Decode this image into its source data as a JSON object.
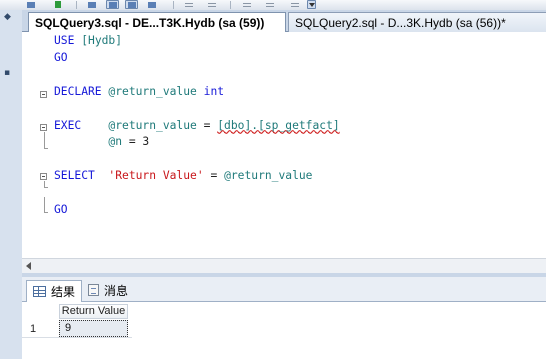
{
  "window": {
    "toolbar": {
      "icons": [
        "save-icon",
        "execute-icon",
        "results-to-text-icon",
        "results-to-grid-icon",
        "results-to-file-icon",
        "comment-icon",
        "uncomment-icon",
        "decrease-indent-icon",
        "increase-indent-icon",
        "specify-values-icon"
      ]
    }
  },
  "tabs": [
    {
      "label": "SQLQuery3.sql - DE...T3K.Hydb (sa (59))",
      "active": true
    },
    {
      "label": "SQLQuery2.sql - D...3K.Hydb (sa (56))*",
      "active": false
    }
  ],
  "editor": {
    "lines": [
      {
        "tokens": [
          {
            "t": "USE ",
            "c": "kw"
          },
          {
            "t": "[Hydb]",
            "c": "var"
          }
        ]
      },
      {
        "tokens": [
          {
            "t": "GO",
            "c": "kw"
          }
        ]
      },
      {
        "tokens": []
      },
      {
        "tokens": [
          {
            "t": "DECLARE ",
            "c": "kw"
          },
          {
            "t": "@return_value ",
            "c": "var"
          },
          {
            "t": "int",
            "c": "kw"
          }
        ]
      },
      {
        "tokens": []
      },
      {
        "tokens": [
          {
            "t": "EXEC    ",
            "c": "kw"
          },
          {
            "t": "@return_value ",
            "c": "var"
          },
          {
            "t": "= ",
            "c": "plain"
          },
          {
            "t": "[dbo].[sp_getfact]",
            "c": "obj"
          }
        ]
      },
      {
        "tokens": [
          {
            "t": "        ",
            "c": "plain"
          },
          {
            "t": "@n ",
            "c": "var"
          },
          {
            "t": "= 3",
            "c": "plain"
          }
        ]
      },
      {
        "tokens": []
      },
      {
        "tokens": [
          {
            "t": "SELECT  ",
            "c": "kw"
          },
          {
            "t": "'Return Value' ",
            "c": "str"
          },
          {
            "t": "= ",
            "c": "plain"
          },
          {
            "t": "@return_value",
            "c": "var"
          }
        ]
      },
      {
        "tokens": []
      },
      {
        "tokens": [
          {
            "t": "GO",
            "c": "kw"
          }
        ]
      }
    ]
  },
  "results": {
    "tabs": [
      {
        "label": "结果",
        "icon": "results-grid-icon",
        "active": true
      },
      {
        "label": "消息",
        "icon": "messages-icon",
        "active": false
      }
    ],
    "columns": [
      "Return Value"
    ],
    "rows": [
      {
        "num": "1",
        "cells": [
          "9"
        ]
      }
    ]
  },
  "colors": {
    "keyword": "#1518d8",
    "string": "#c8171b",
    "identifier": "#1f7a7a"
  }
}
